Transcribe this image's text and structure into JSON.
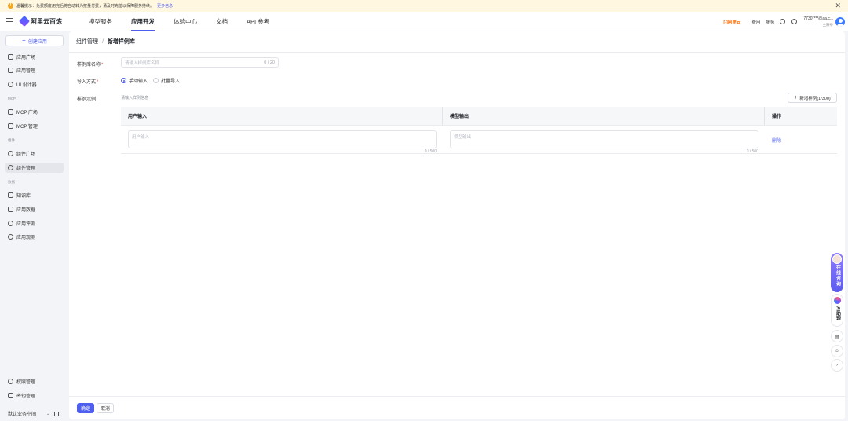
{
  "banner": {
    "text": "温馨提示：免费额度用完后将自动转为按量付费，请及时充值以保障服务持续。",
    "link": "更多信息",
    "close": "✕"
  },
  "nav": {
    "logo": "阿里云百炼",
    "items": [
      "模型服务",
      "应用开发",
      "体验中心",
      "文档",
      "API 参考"
    ],
    "active_index": 1,
    "brand_badge": "[-]阿里云",
    "right_items": [
      "费用",
      "服务"
    ],
    "account_name": "7730****@aa.c...",
    "account_sub": "主账号"
  },
  "sidebar": {
    "create_label": "创建应用",
    "groups": {
      "mcp": "MCP",
      "component": "组件",
      "data": "数据"
    },
    "items": [
      {
        "label": "应用广场"
      },
      {
        "label": "应用管理"
      },
      {
        "label": "UI 设计器"
      },
      {
        "label": "MCP 广场"
      },
      {
        "label": "MCP 管理"
      },
      {
        "label": "组件广场"
      },
      {
        "label": "组件管理"
      },
      {
        "label": "知识库"
      },
      {
        "label": "应用数据"
      },
      {
        "label": "应用评测"
      },
      {
        "label": "应用观测"
      },
      {
        "label": "权限管理"
      },
      {
        "label": "密钥管理"
      }
    ],
    "workspace": "默认业务空间"
  },
  "main": {
    "breadcrumb_parent": "组件管理",
    "breadcrumb_sep": "/",
    "breadcrumb_current": "新增样例库",
    "form": {
      "name_label": "样例库名称",
      "name_placeholder": "请输入样例库名称",
      "name_count": "0 / 20",
      "import_label": "导入方式",
      "import_options": [
        "手动输入",
        "批量导入"
      ],
      "import_selected": "手动输入",
      "example_label": "样例示例",
      "example_hint": "请输入样例信息",
      "add_example": "新增样例(1/300)"
    },
    "table": {
      "headers": [
        "用户输入",
        "模型输出",
        "操作"
      ],
      "rows": [
        {
          "input_placeholder": "用户输入",
          "input_count": "0 / 500",
          "output_placeholder": "模型输出",
          "output_count": "0 / 500",
          "action": "删除"
        }
      ]
    },
    "footer": {
      "ok": "确定",
      "cancel": "取消"
    }
  },
  "floating": {
    "consult": "在线咨询",
    "ai": "AI助理"
  }
}
